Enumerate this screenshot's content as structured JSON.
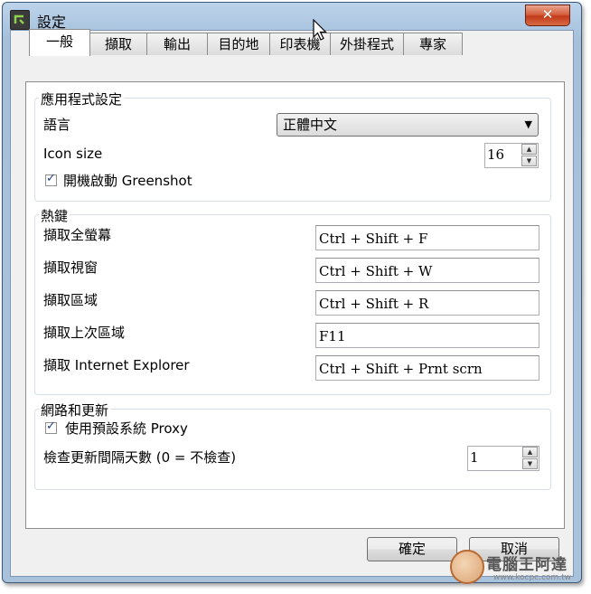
{
  "window": {
    "title": "設定",
    "close_symbol": "✕",
    "icon": "greenshot-app-icon"
  },
  "tabs": [
    {
      "label": "一般",
      "active": true
    },
    {
      "label": "擷取",
      "active": false
    },
    {
      "label": "輸出",
      "active": false
    },
    {
      "label": "目的地",
      "active": false
    },
    {
      "label": "印表機",
      "active": false
    },
    {
      "label": "外掛程式",
      "active": false
    },
    {
      "label": "專家",
      "active": false
    }
  ],
  "app_settings": {
    "legend": "應用程式設定",
    "language_label": "語言",
    "language_value": "正體中文",
    "icon_size_label": "Icon size",
    "icon_size_value": "16",
    "autostart_checked": true,
    "autostart_label": "開機啟動 Greenshot"
  },
  "hotkeys": {
    "legend": "熱鍵",
    "rows": [
      {
        "label": "擷取全螢幕",
        "value": "Ctrl + Shift + F"
      },
      {
        "label": "擷取視窗",
        "value": "Ctrl + Shift + W"
      },
      {
        "label": "擷取區域",
        "value": "Ctrl + Shift + R"
      },
      {
        "label": "擷取上次區域",
        "value": "F11"
      },
      {
        "label": "擷取 Internet Explorer",
        "value": "Ctrl + Shift + Prnt scrn"
      }
    ]
  },
  "network": {
    "legend": "網路和更新",
    "proxy_checked": true,
    "proxy_label": "使用預設系統 Proxy",
    "interval_label": "檢查更新間隔天數 (0 = 不檢查)",
    "interval_value": "1"
  },
  "buttons": {
    "ok": "確定",
    "cancel": "取消"
  },
  "watermark": {
    "text": "電腦王阿達",
    "url": "www.kocpc.com.tw"
  },
  "colors": {
    "title_bar": "#a9c2dc",
    "close_button": "#c23a1a",
    "panel_background": "#ffffff",
    "dialog_background": "#f0f0f0"
  }
}
